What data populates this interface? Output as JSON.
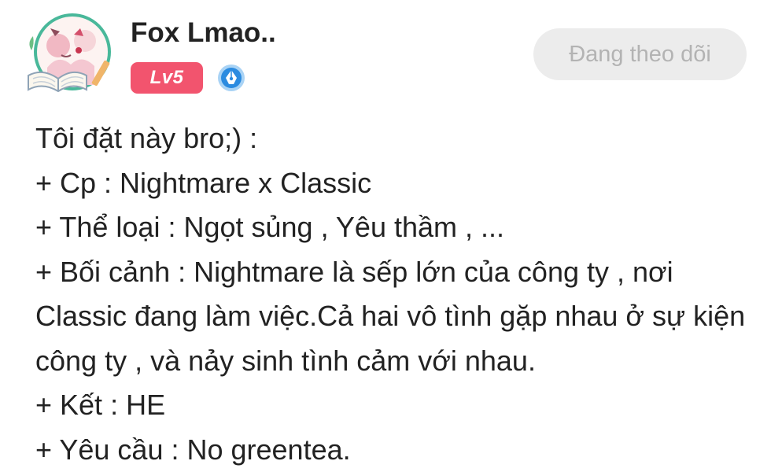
{
  "post": {
    "author": {
      "name": "Fox Lmao..",
      "level": "Lv5",
      "avatar_icon": "anime-characters-avatar",
      "badge_icon": "pen-nib-icon"
    },
    "follow_button": "Đang theo dõi",
    "content": [
      "Tôi đặt này bro;) :",
      "+ Cp : Nightmare x Classic",
      "+ Thể loại : Ngọt sủng , Yêu thầm , ...",
      "+ Bối cảnh : Nightmare là sếp lớn của công ty , nơi Classic đang làm việc.Cả hai vô tình gặp nhau ở sự kiện công ty , và nảy sinh tình cảm với nhau.",
      "+ Kết : HE",
      "+ Yêu cầu : No greentea."
    ]
  },
  "colors": {
    "level_badge": "#f2546e",
    "follow_button_bg": "#ececec",
    "follow_button_text": "#b3b3b3",
    "avatar_ring": "#49b89a",
    "pen_badge": "#2b8be0"
  }
}
